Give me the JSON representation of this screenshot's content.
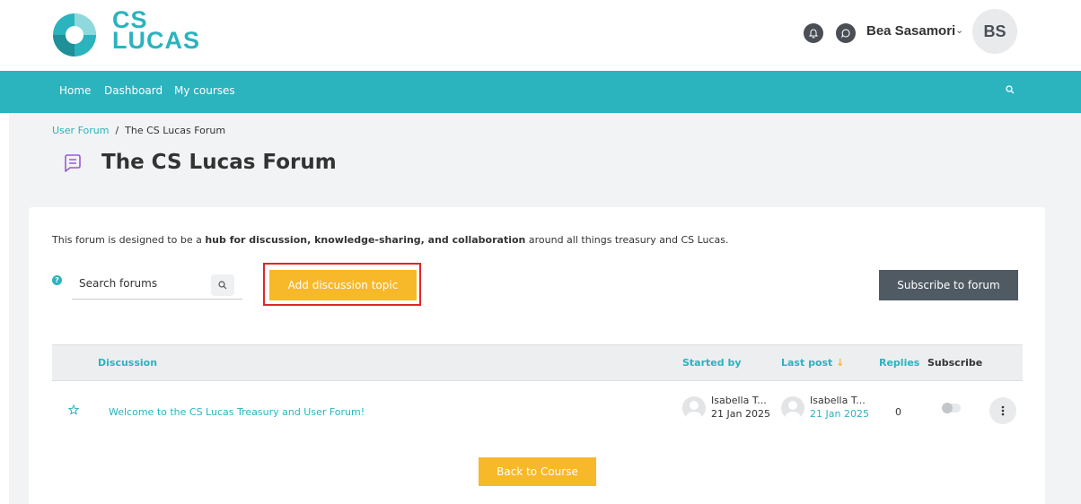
{
  "brand": {
    "line1": "CS",
    "line2": "LUCAS",
    "accent": "#2bb3be",
    "dark": "#4a4e55"
  },
  "header": {
    "notifications_icon": "bell-icon",
    "messages_icon": "chat-bubble-icon",
    "user_name": "Bea Sasamori",
    "user_menu_icon": "chevron-down-icon",
    "avatar_initials": "BS"
  },
  "nav": {
    "items": [
      {
        "label": "Home"
      },
      {
        "label": "Dashboard"
      },
      {
        "label": "My courses"
      }
    ],
    "search_icon": "search-icon"
  },
  "breadcrumb": {
    "parent": "User Forum",
    "separator": "/",
    "current": "The CS Lucas Forum"
  },
  "page": {
    "title": "The CS Lucas Forum",
    "title_icon": "forum-icon"
  },
  "intro": {
    "before": "This forum is designed to be a ",
    "bold": "hub for discussion, knowledge-sharing, and collaboration",
    "after": " around all things treasury and CS Lucas."
  },
  "search": {
    "placeholder": "Search forums",
    "help_icon": "?"
  },
  "buttons": {
    "add_topic": "Add discussion topic",
    "subscribe": "Subscribe to forum",
    "back": "Back to Course"
  },
  "table": {
    "headers": {
      "discussion": "Discussion",
      "started_by": "Started by",
      "last_post": "Last post",
      "sort_indicator": "↓",
      "replies": "Replies",
      "subscribe": "Subscribe"
    },
    "rows": [
      {
        "title": "Welcome to the CS Lucas Treasury and User Forum!",
        "started_by": {
          "name": "Isabella T...",
          "date": "21 Jan 2025"
        },
        "last_post": {
          "name": "Isabella T...",
          "date": "21 Jan 2025"
        },
        "replies": "0",
        "subscribed": false
      }
    ]
  },
  "colors": {
    "primary": "#2bb3be",
    "warning": "#f7b829",
    "secondary": "#505a63",
    "highlight_border": "#e0262b"
  }
}
